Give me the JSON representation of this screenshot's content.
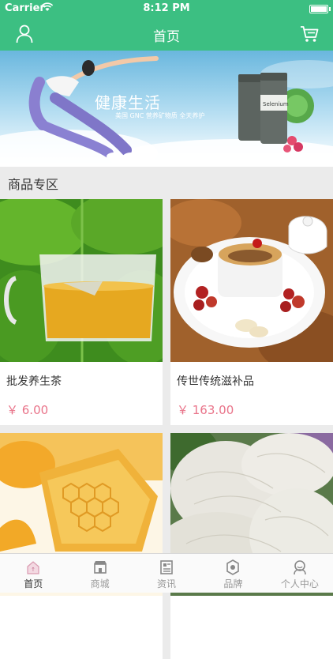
{
  "status_bar": {
    "carrier": "Carrier",
    "time": "8:12 PM"
  },
  "navbar": {
    "title": "首页",
    "user_icon": "user-icon",
    "cart_icon": "cart-icon",
    "color": "#3cbf82"
  },
  "banner": {
    "title": "健康生活",
    "subtitle": "美国 GNC 营养矿物质 全天养护",
    "product_label": "Selenium"
  },
  "section": {
    "title": "商品专区"
  },
  "products": [
    {
      "name": "批发养生茶",
      "price": "￥ 6.00"
    },
    {
      "name": "传世传统滋补品",
      "price": "￥ 163.00"
    },
    {
      "name": "",
      "price": ""
    },
    {
      "name": "",
      "price": ""
    }
  ],
  "tabbar": {
    "items": [
      {
        "label": "首页",
        "icon": "home-icon",
        "active": true
      },
      {
        "label": "商城",
        "icon": "store-icon",
        "active": false
      },
      {
        "label": "资讯",
        "icon": "news-icon",
        "active": false
      },
      {
        "label": "品牌",
        "icon": "brand-icon",
        "active": false
      },
      {
        "label": "个人中心",
        "icon": "profile-icon",
        "active": false
      }
    ]
  },
  "colors": {
    "accent": "#3cbf82",
    "price": "#e9748a"
  }
}
